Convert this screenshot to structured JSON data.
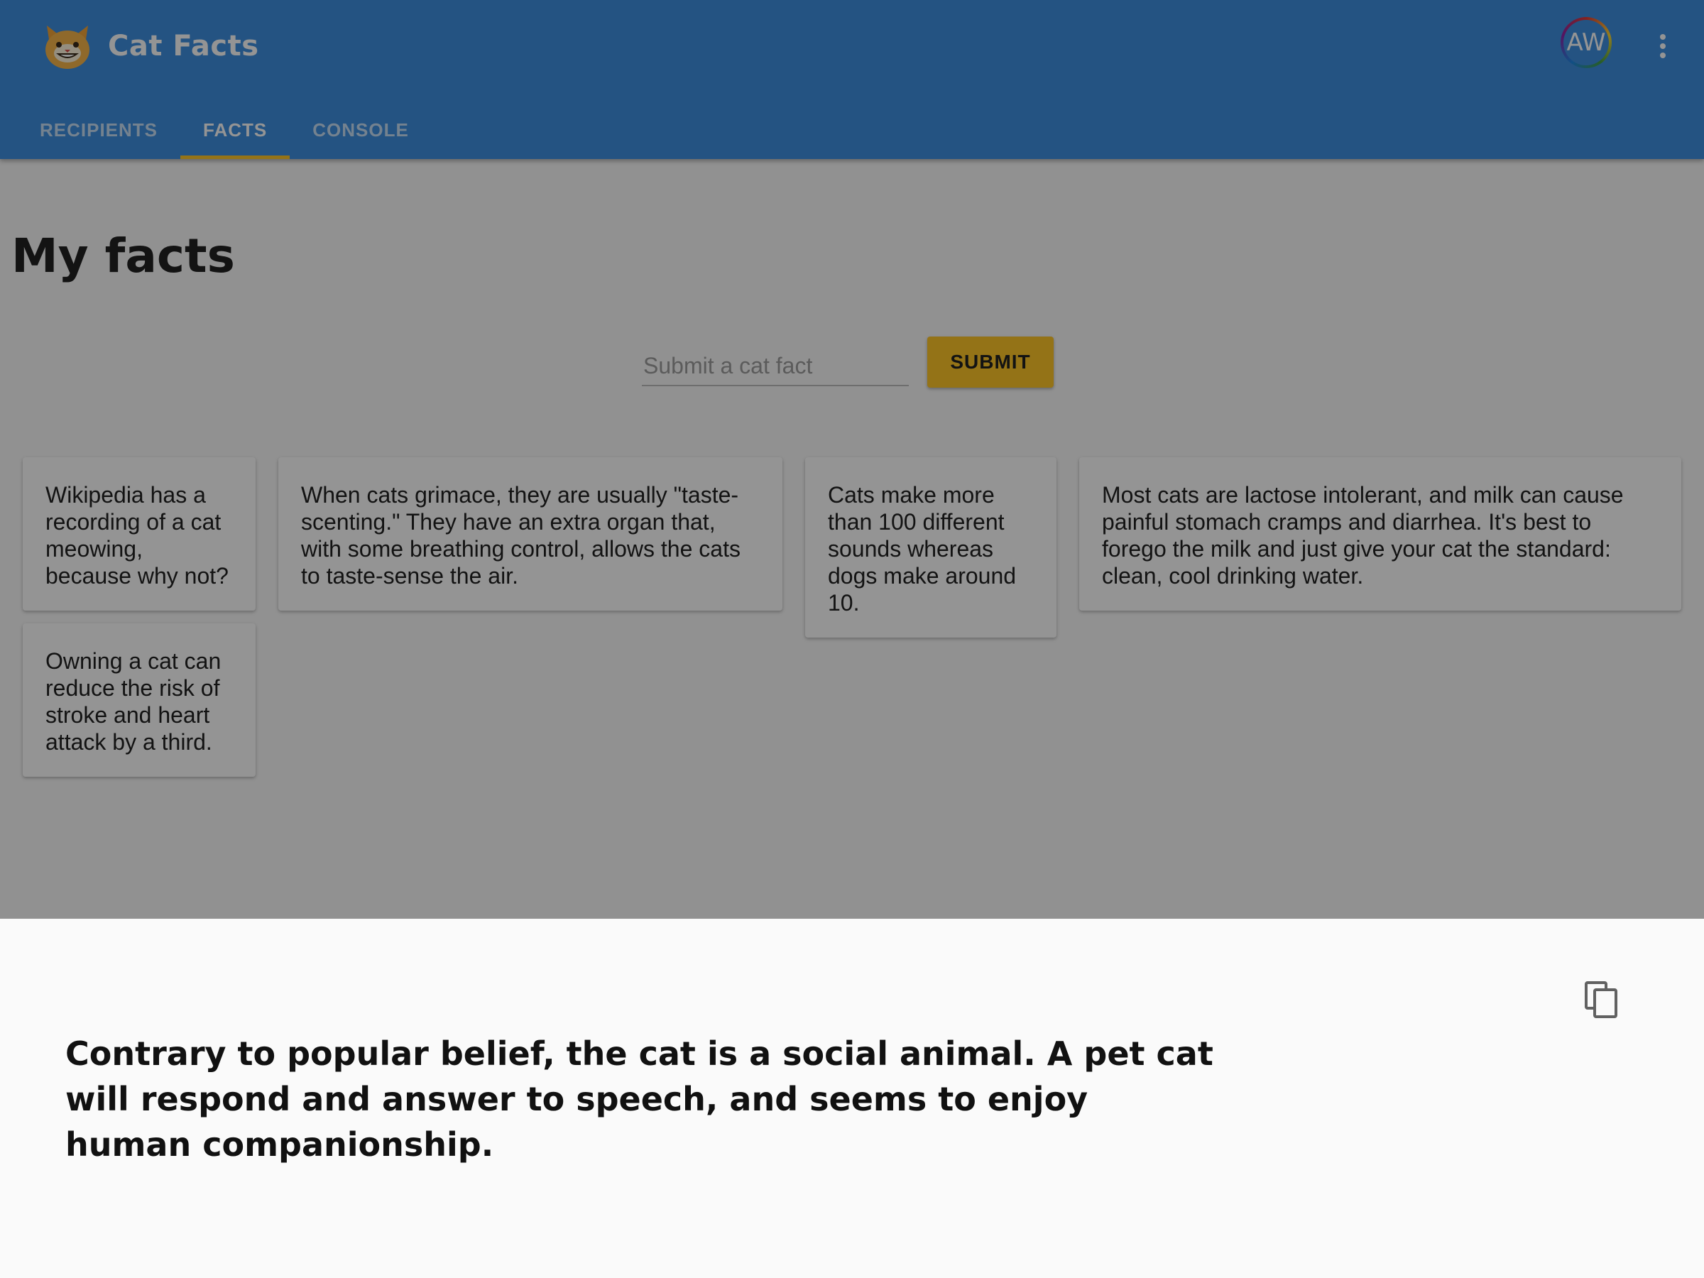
{
  "app": {
    "title": "Cat Facts",
    "logo_icon": "cat-logo-icon",
    "avatar_initials": "AW",
    "menu_icon": "more-vert-icon"
  },
  "tabs": [
    {
      "label": "RECIPIENTS",
      "active": false
    },
    {
      "label": "FACTS",
      "active": true
    },
    {
      "label": "CONSOLE",
      "active": false
    }
  ],
  "main": {
    "title": "My facts",
    "input_placeholder": "Submit a cat fact",
    "input_value": "",
    "submit_label": "SUBMIT",
    "facts": [
      "Wikipedia has a recording of a cat meowing, because why not?",
      "When cats grimace, they are usually \"taste-scenting.\" They have an extra organ that, with some breathing control, allows the cats to taste-sense the air.",
      "Cats make more than 100 different sounds whereas dogs make around 10.",
      "Most cats are lactose intolerant, and milk can cause painful stomach cramps and diarrhea. It's best to forego the milk and just give your cat the standard: clean, cool drinking water.",
      "Owning a cat can reduce the risk of stroke and heart attack by a third."
    ]
  },
  "bottom_sheet": {
    "fact": "Contrary to popular belief, the cat is a social animal. A pet cat will respond and answer to speech, and seems to enjoy human companionship.",
    "copy_icon": "copy-icon"
  },
  "colors": {
    "primary": "#3f8fe0",
    "accent": "#ffc629",
    "scrim": "rgba(0,0,0,0.42)"
  }
}
